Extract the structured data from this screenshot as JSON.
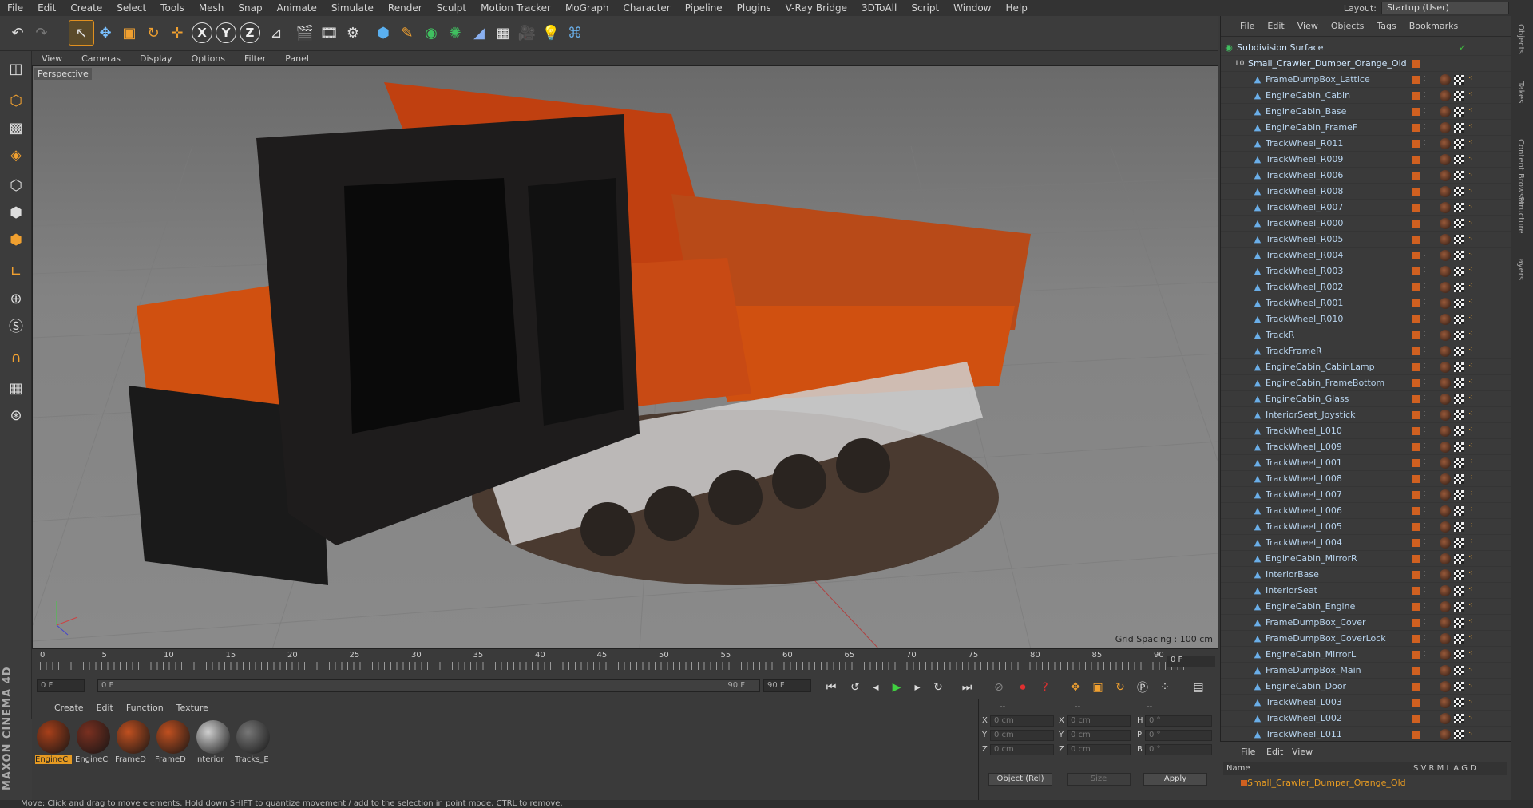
{
  "menu": [
    "File",
    "Edit",
    "Create",
    "Select",
    "Tools",
    "Mesh",
    "Snap",
    "Animate",
    "Simulate",
    "Render",
    "Sculpt",
    "Motion Tracker",
    "MoGraph",
    "Character",
    "Pipeline",
    "Plugins",
    "V-Ray Bridge",
    "3DToAll",
    "Script",
    "Window",
    "Help"
  ],
  "layout": {
    "label": "Layout:",
    "value": "Startup (User)"
  },
  "viewport": {
    "menu": [
      "View",
      "Cameras",
      "Display",
      "Options",
      "Filter",
      "Panel"
    ],
    "label": "Perspective",
    "grid": "Grid Spacing : 100 cm"
  },
  "timeline": {
    "ticks": [
      "0",
      "5",
      "10",
      "15",
      "20",
      "25",
      "30",
      "35",
      "40",
      "45",
      "50",
      "55",
      "60",
      "65",
      "70",
      "75",
      "80",
      "85",
      "90"
    ],
    "current": "0 F"
  },
  "transport": {
    "start": "0 F",
    "range_start": "0 F",
    "range_end": "90 F",
    "end": "90 F"
  },
  "materials": {
    "menu": [
      "Create",
      "Edit",
      "Function",
      "Texture"
    ],
    "items": [
      {
        "name": "EngineC",
        "selected": true
      },
      {
        "name": "EngineC",
        "selected": false
      },
      {
        "name": "FrameD",
        "selected": false
      },
      {
        "name": "FrameD",
        "selected": false
      },
      {
        "name": "Interior",
        "selected": false
      },
      {
        "name": "Tracks_E",
        "selected": false
      }
    ]
  },
  "coords": {
    "header": [
      "--",
      "--",
      "--"
    ],
    "rows": [
      {
        "a": "X",
        "av": "0 cm",
        "b": "X",
        "bv": "0 cm",
        "c": "H",
        "cv": "0 °"
      },
      {
        "a": "Y",
        "av": "0 cm",
        "b": "Y",
        "bv": "0 cm",
        "c": "P",
        "cv": "0 °"
      },
      {
        "a": "Z",
        "av": "0 cm",
        "b": "Z",
        "bv": "0 cm",
        "c": "B",
        "cv": "0 °"
      }
    ],
    "mode": "Object (Rel)",
    "size": "Size",
    "apply": "Apply"
  },
  "status": "Move: Click and drag to move elements. Hold down SHIFT to quantize movement / add to the selection in point mode, CTRL to remove.",
  "logo": "MAXON CINEMA 4D",
  "objects": {
    "menu": [
      "File",
      "Edit",
      "View",
      "Objects",
      "Tags",
      "Bookmarks"
    ],
    "root": "Subdivision Surface",
    "group": "Small_Crawler_Dumper_Orange_Old",
    "items": [
      "FrameDumpBox_Lattice",
      "EngineCabin_Cabin",
      "EngineCabin_Base",
      "EngineCabin_FrameF",
      "TrackWheel_R011",
      "TrackWheel_R009",
      "TrackWheel_R006",
      "TrackWheel_R008",
      "TrackWheel_R007",
      "TrackWheel_R000",
      "TrackWheel_R005",
      "TrackWheel_R004",
      "TrackWheel_R003",
      "TrackWheel_R002",
      "TrackWheel_R001",
      "TrackWheel_R010",
      "TrackR",
      "TrackFrameR",
      "EngineCabin_CabinLamp",
      "EngineCabin_FrameBottom",
      "EngineCabin_Glass",
      "InteriorSeat_Joystick",
      "TrackWheel_L010",
      "TrackWheel_L009",
      "TrackWheel_L001",
      "TrackWheel_L008",
      "TrackWheel_L007",
      "TrackWheel_L006",
      "TrackWheel_L005",
      "TrackWheel_L004",
      "EngineCabin_MirrorR",
      "InteriorBase",
      "InteriorSeat",
      "EngineCabin_Engine",
      "FrameDumpBox_Cover",
      "FrameDumpBox_CoverLock",
      "EngineCabin_MirrorL",
      "FrameDumpBox_Main",
      "EngineCabin_Door",
      "TrackWheel_L003",
      "TrackWheel_L002",
      "TrackWheel_L011"
    ]
  },
  "layers": {
    "menu": [
      "File",
      "Edit",
      "View"
    ],
    "header": "Name",
    "cols": "S V R M L A G D",
    "row": "Small_Crawler_Dumper_Orange_Old"
  },
  "sidetabs": [
    "Objects",
    "Takes",
    "Content Browser",
    "Structure",
    "Layers"
  ]
}
